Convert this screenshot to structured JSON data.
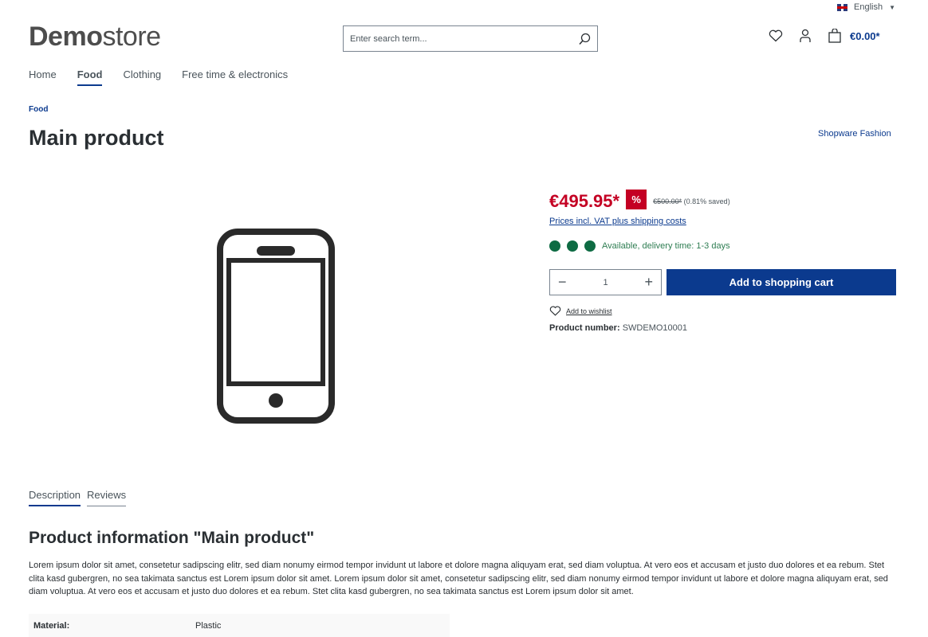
{
  "header": {
    "language": "English",
    "logo_bold": "Demo",
    "logo_light": "store",
    "search_placeholder": "Enter search term...",
    "cart_total": "€0.00*"
  },
  "nav": [
    {
      "label": "Home",
      "active": false
    },
    {
      "label": "Food",
      "active": true
    },
    {
      "label": "Clothing",
      "active": false
    },
    {
      "label": "Free time & electronics",
      "active": false
    }
  ],
  "breadcrumb": "Food",
  "product": {
    "title": "Main product",
    "manufacturer": "Shopware Fashion",
    "price": "€495.95*",
    "discount_badge": "%",
    "old_price": "€500.00*",
    "saved": "(0.81% saved)",
    "vat_link": "Prices incl. VAT plus shipping costs",
    "availability": "Available, delivery time: 1-3 days",
    "quantity": "1",
    "add_to_cart": "Add to shopping cart",
    "add_to_wishlist": "Add to wishlist",
    "product_number_label": "Product number:",
    "product_number": "SWDEMO10001"
  },
  "tabs": [
    {
      "label": "Description",
      "active": true
    },
    {
      "label": "Reviews",
      "active": false
    }
  ],
  "description": {
    "heading": "Product information \"Main product\"",
    "text": "Lorem ipsum dolor sit amet, consetetur sadipscing elitr, sed diam nonumy eirmod tempor invidunt ut labore et dolore magna aliquyam erat, sed diam voluptua. At vero eos et accusam et justo duo dolores et ea rebum. Stet clita kasd gubergren, no sea takimata sanctus est Lorem ipsum dolor sit amet. Lorem ipsum dolor sit amet, consetetur sadipscing elitr, sed diam nonumy eirmod tempor invidunt ut labore et dolore magna aliquyam erat, sed diam voluptua. At vero eos et accusam et justo duo dolores et ea rebum. Stet clita kasd gubergren, no sea takimata sanctus est Lorem ipsum dolor sit amet.",
    "properties": [
      {
        "key": "Material:",
        "value": "Plastic"
      }
    ]
  }
}
